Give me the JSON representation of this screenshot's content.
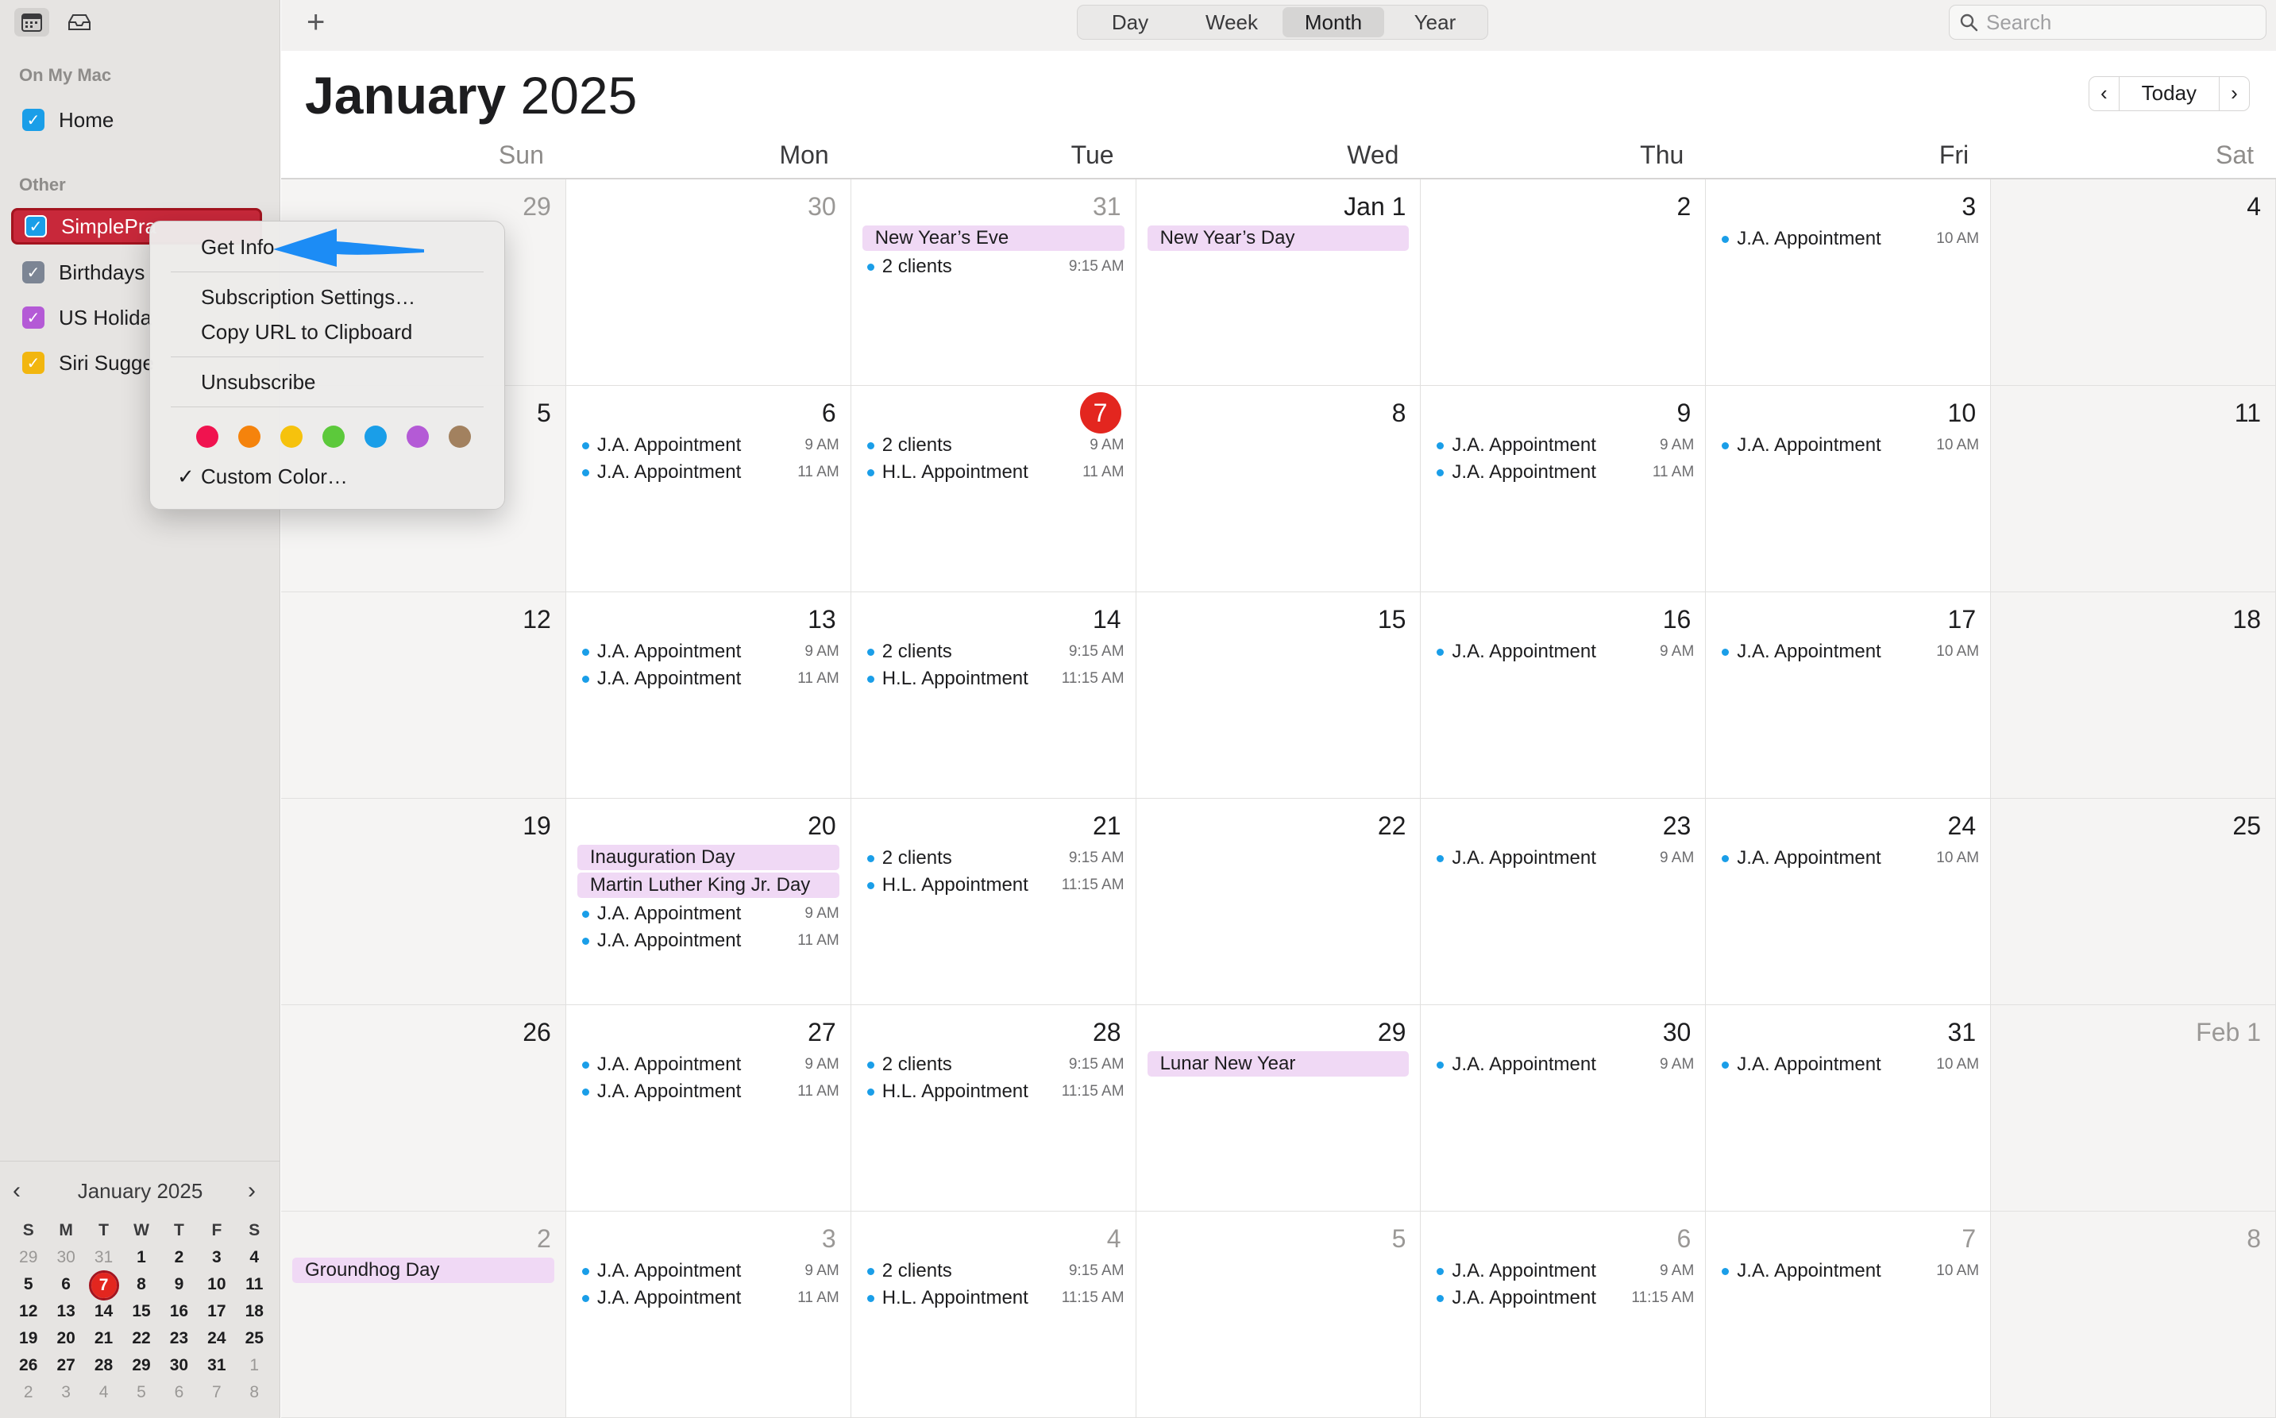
{
  "sidebar": {
    "sections": {
      "on_my_mac": "On My Mac",
      "other": "Other"
    },
    "calendars": [
      {
        "label": "Home",
        "color": "#1a9ee8",
        "checked": true
      },
      {
        "label": "SimplePra",
        "color": "#1a9ee8",
        "checked": true,
        "selected": true
      },
      {
        "label": "Birthdays",
        "color": "#7c8594",
        "checked": true
      },
      {
        "label": "US Holida",
        "color": "#b45ad6",
        "checked": true
      },
      {
        "label": "Siri Sugge",
        "color": "#f2b60f",
        "checked": true
      }
    ]
  },
  "mini_calendar": {
    "title": "January 2025",
    "weekday_headers": [
      "S",
      "M",
      "T",
      "W",
      "T",
      "F",
      "S"
    ],
    "weeks": [
      [
        "29",
        "30",
        "31",
        "1",
        "2",
        "3",
        "4"
      ],
      [
        "5",
        "6",
        "7",
        "8",
        "9",
        "10",
        "11"
      ],
      [
        "12",
        "13",
        "14",
        "15",
        "16",
        "17",
        "18"
      ],
      [
        "19",
        "20",
        "21",
        "22",
        "23",
        "24",
        "25"
      ],
      [
        "26",
        "27",
        "28",
        "29",
        "30",
        "31",
        "1"
      ],
      [
        "2",
        "3",
        "4",
        "5",
        "6",
        "7",
        "8"
      ]
    ]
  },
  "toolbar": {
    "add_label": "+",
    "views": [
      "Day",
      "Week",
      "Month",
      "Year"
    ],
    "active_view": "Month",
    "search_placeholder": "Search"
  },
  "header": {
    "month": "January",
    "year": "2025",
    "today_label": "Today"
  },
  "weekdays": [
    "Sun",
    "Mon",
    "Tue",
    "Wed",
    "Thu",
    "Fri",
    "Sat"
  ],
  "weeks": [
    [
      {
        "day": "29",
        "dim": true,
        "events": []
      },
      {
        "day": "30",
        "dim": true,
        "events": []
      },
      {
        "day": "31",
        "dim": true,
        "allday": [
          "New Year’s Eve"
        ],
        "events": [
          {
            "title": "2 clients",
            "time": "9:15 AM"
          }
        ]
      },
      {
        "day": "Jan 1",
        "allday": [
          "New Year’s Day"
        ],
        "events": []
      },
      {
        "day": "2",
        "events": []
      },
      {
        "day": "3",
        "events": [
          {
            "title": "J.A. Appointment",
            "time": "10 AM"
          }
        ]
      },
      {
        "day": "4",
        "events": []
      }
    ],
    [
      {
        "day": "5",
        "events": []
      },
      {
        "day": "6",
        "events": [
          {
            "title": "J.A. Appointment",
            "time": "9 AM"
          },
          {
            "title": "J.A. Appointment",
            "time": "11 AM"
          }
        ]
      },
      {
        "day": "7",
        "today": true,
        "events": [
          {
            "title": "2 clients",
            "time": "9 AM"
          },
          {
            "title": "H.L. Appointment",
            "time": "11 AM"
          }
        ]
      },
      {
        "day": "8",
        "events": []
      },
      {
        "day": "9",
        "events": [
          {
            "title": "J.A. Appointment",
            "time": "9 AM"
          },
          {
            "title": "J.A. Appointment",
            "time": "11 AM"
          }
        ]
      },
      {
        "day": "10",
        "events": [
          {
            "title": "J.A. Appointment",
            "time": "10 AM"
          }
        ]
      },
      {
        "day": "11",
        "events": []
      }
    ],
    [
      {
        "day": "12",
        "events": []
      },
      {
        "day": "13",
        "events": [
          {
            "title": "J.A. Appointment",
            "time": "9 AM"
          },
          {
            "title": "J.A. Appointment",
            "time": "11 AM"
          }
        ]
      },
      {
        "day": "14",
        "events": [
          {
            "title": "2 clients",
            "time": "9:15 AM"
          },
          {
            "title": "H.L. Appointment",
            "time": "11:15 AM"
          }
        ]
      },
      {
        "day": "15",
        "events": []
      },
      {
        "day": "16",
        "events": [
          {
            "title": "J.A. Appointment",
            "time": "9 AM"
          }
        ]
      },
      {
        "day": "17",
        "events": [
          {
            "title": "J.A. Appointment",
            "time": "10 AM"
          }
        ]
      },
      {
        "day": "18",
        "events": []
      }
    ],
    [
      {
        "day": "19",
        "events": []
      },
      {
        "day": "20",
        "allday": [
          "Inauguration Day",
          "Martin Luther King Jr. Day"
        ],
        "events": [
          {
            "title": "J.A. Appointment",
            "time": "9 AM"
          },
          {
            "title": "J.A. Appointment",
            "time": "11 AM"
          }
        ]
      },
      {
        "day": "21",
        "events": [
          {
            "title": "2 clients",
            "time": "9:15 AM"
          },
          {
            "title": "H.L. Appointment",
            "time": "11:15 AM"
          }
        ]
      },
      {
        "day": "22",
        "events": []
      },
      {
        "day": "23",
        "events": [
          {
            "title": "J.A. Appointment",
            "time": "9 AM"
          }
        ]
      },
      {
        "day": "24",
        "events": [
          {
            "title": "J.A. Appointment",
            "time": "10 AM"
          }
        ]
      },
      {
        "day": "25",
        "events": []
      }
    ],
    [
      {
        "day": "26",
        "events": []
      },
      {
        "day": "27",
        "events": [
          {
            "title": "J.A. Appointment",
            "time": "9 AM"
          },
          {
            "title": "J.A. Appointment",
            "time": "11 AM"
          }
        ]
      },
      {
        "day": "28",
        "events": [
          {
            "title": "2 clients",
            "time": "9:15 AM"
          },
          {
            "title": "H.L. Appointment",
            "time": "11:15 AM"
          }
        ]
      },
      {
        "day": "29",
        "allday": [
          "Lunar New Year"
        ],
        "events": []
      },
      {
        "day": "30",
        "events": [
          {
            "title": "J.A. Appointment",
            "time": "9 AM"
          }
        ]
      },
      {
        "day": "31",
        "events": [
          {
            "title": "J.A. Appointment",
            "time": "10 AM"
          }
        ]
      },
      {
        "day": "Feb 1",
        "dim": true,
        "events": []
      }
    ],
    [
      {
        "day": "2",
        "dim": true,
        "allday": [
          "Groundhog Day"
        ],
        "events": []
      },
      {
        "day": "3",
        "dim": true,
        "events": [
          {
            "title": "J.A. Appointment",
            "time": "9 AM"
          },
          {
            "title": "J.A. Appointment",
            "time": "11 AM"
          }
        ]
      },
      {
        "day": "4",
        "dim": true,
        "events": [
          {
            "title": "2 clients",
            "time": "9:15 AM"
          },
          {
            "title": "H.L. Appointment",
            "time": "11:15 AM"
          }
        ]
      },
      {
        "day": "5",
        "dim": true,
        "events": []
      },
      {
        "day": "6",
        "dim": true,
        "events": [
          {
            "title": "J.A. Appointment",
            "time": "9 AM"
          },
          {
            "title": "J.A. Appointment",
            "time": "11:15 AM"
          }
        ]
      },
      {
        "day": "7",
        "dim": true,
        "events": [
          {
            "title": "J.A. Appointment",
            "time": "10 AM"
          }
        ]
      },
      {
        "day": "8",
        "dim": true,
        "events": []
      }
    ]
  ],
  "context_menu": {
    "get_info": "Get Info",
    "subscription_settings": "Subscription Settings…",
    "copy_url": "Copy URL to Clipboard",
    "unsubscribe": "Unsubscribe",
    "custom_color": "Custom Color…",
    "check_mark": "✓",
    "swatches": [
      "#f0134f",
      "#f5830c",
      "#f6c20d",
      "#5cc93b",
      "#1a9ee8",
      "#b45ad6",
      "#a2815f"
    ]
  },
  "colors": {
    "accent_red": "#e3261f",
    "event_dot": "#1a9ee8",
    "allday_bg": "#f0d9f5",
    "arrow_blue": "#1c8cf5"
  }
}
